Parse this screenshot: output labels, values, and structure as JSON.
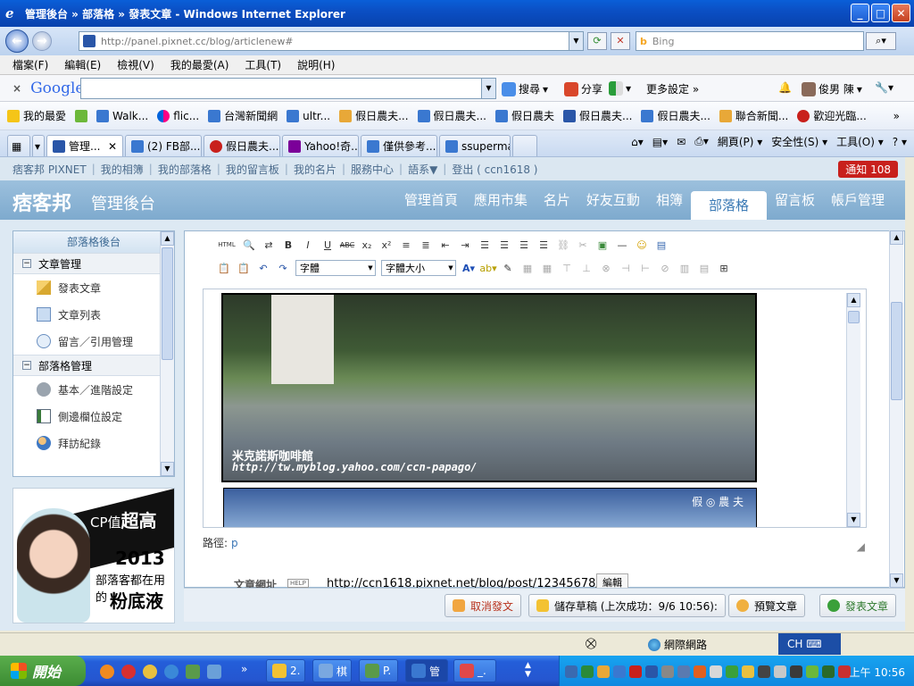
{
  "window": {
    "title": "管理後台 » 部落格 » 發表文章 - Windows Internet Explorer",
    "min": "_",
    "max": "□",
    "close": "✕"
  },
  "address": {
    "url": "http://panel.pixnet.cc/blog/articlenew#",
    "bing_placeholder": "Bing"
  },
  "menu": [
    "檔案(F)",
    "編輯(E)",
    "檢視(V)",
    "我的最愛(A)",
    "工具(T)",
    "說明(H)"
  ],
  "google_toolbar": {
    "logo": "Google",
    "close": "×",
    "items": [
      "搜尋",
      "分享",
      "更多設定 »",
      "俊男 陳"
    ]
  },
  "favorites": {
    "label": "我的最愛",
    "items": [
      "Walk...",
      "flic...",
      "台灣新聞網",
      "ultr...",
      "假日農夫...",
      "假日農夫...",
      "假日農夫",
      "假日農夫...",
      "假日農夫...",
      "聯合新聞...",
      "歡迎光臨..."
    ],
    "more": "»"
  },
  "tabs": [
    {
      "label": "管理...",
      "active": true
    },
    {
      "label": "(2) FB部...",
      "active": false
    },
    {
      "label": "假日農夫...",
      "active": false
    },
    {
      "label": "Yahoo!奇...",
      "active": false
    },
    {
      "label": "僅供參考...",
      "active": false
    },
    {
      "label": "ssuperma...",
      "active": false
    }
  ],
  "tab_tools": [
    "網頁(P)",
    "安全性(S)",
    "工具(O)",
    "?"
  ],
  "top_links": [
    "痞客邦 PIXNET",
    "我的相簿",
    "我的部落格",
    "我的留言板",
    "我的名片",
    "服務中心",
    "語系▼",
    "登出 ( ccn1618 )"
  ],
  "notify": "通知 108",
  "header": {
    "logo": "痞客邦",
    "subtitle": "管理後台",
    "nav": [
      "管理首頁",
      "應用市集",
      "名片",
      "好友互動",
      "相簿",
      "部落格",
      "留言板",
      "帳戶管理"
    ],
    "active": "部落格"
  },
  "sidebar": {
    "title": "部落格後台",
    "groups": [
      {
        "label": "文章管理",
        "items": [
          "發表文章",
          "文章列表",
          "留言／引用管理"
        ]
      },
      {
        "label": "部落格管理",
        "items": [
          "基本／進階設定",
          "側邊欄位設定",
          "拜訪紀錄"
        ]
      }
    ]
  },
  "ad": {
    "line1_a": "CP值",
    "line1_b": "超高",
    "year": "2013",
    "line2": "部落客都在用的",
    "line3": "粉底液"
  },
  "editor": {
    "font_select": "字體",
    "size_select": "字體大小",
    "caption1": "米克諾斯咖啡館",
    "caption2": "http://tw.myblog.yahoo.com/ccn-papago/",
    "watermark": "假 ◎ 農 夫",
    "path_label": "路徑:",
    "path_value": "p"
  },
  "article_url": {
    "label": "文章網址",
    "help": "HELP",
    "value": "http://ccn1618.pixnet.net/blog/post/12345678/",
    "edit": "編輯"
  },
  "actions": {
    "cancel": "取消發文",
    "draft": "儲存草稿 (上次成功：9/6 10:56):",
    "preview": "預覽文章",
    "publish": "發表文章"
  },
  "status": {
    "zone": "網際網路",
    "ime": "CH"
  },
  "taskbar": {
    "start": "開始",
    "items": [
      "2.",
      "棋",
      "P.",
      "管",
      "_."
    ],
    "clock": "上午 10:56"
  }
}
